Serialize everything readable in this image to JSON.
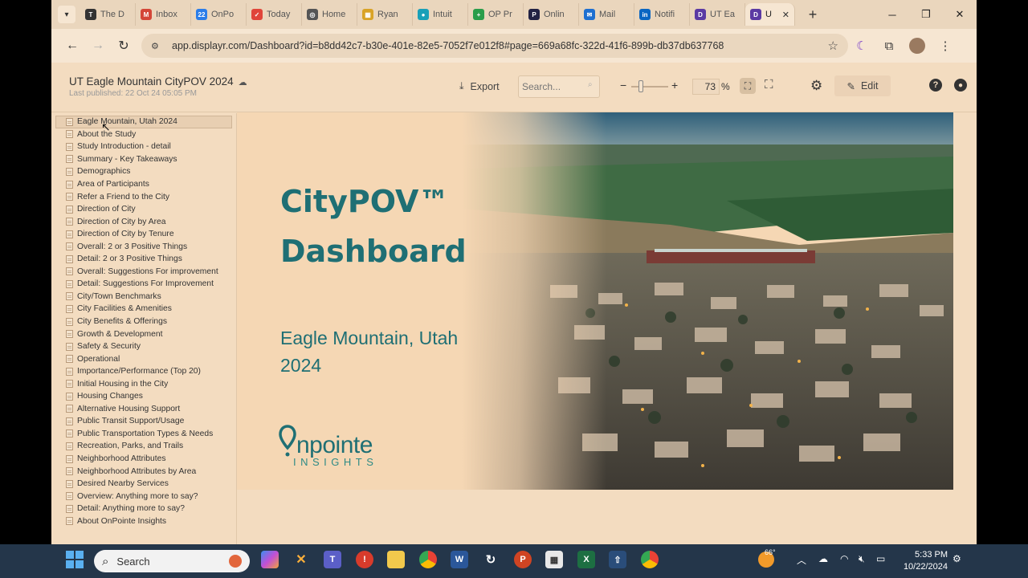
{
  "browser": {
    "tabs": [
      {
        "label": "The D",
        "color": "#333333",
        "glyph": "T"
      },
      {
        "label": "Inbox",
        "color": "#d44638",
        "glyph": "M"
      },
      {
        "label": "OnPo",
        "color": "#2b7de9",
        "glyph": "22"
      },
      {
        "label": "Today",
        "color": "#e0453a",
        "glyph": "✓"
      },
      {
        "label": "Home",
        "color": "#555555",
        "glyph": "◎"
      },
      {
        "label": "Ryan",
        "color": "#d9a326",
        "glyph": "▦"
      },
      {
        "label": "Intuit",
        "color": "#1aa0b8",
        "glyph": "●"
      },
      {
        "label": "OP Pr",
        "color": "#2a9d4a",
        "glyph": "+"
      },
      {
        "label": "Onlin",
        "color": "#222244",
        "glyph": "P"
      },
      {
        "label": "Mail",
        "color": "#1e6fd0",
        "glyph": "✉"
      },
      {
        "label": "Notifi",
        "color": "#0a66c2",
        "glyph": "in"
      },
      {
        "label": "UT Ea",
        "color": "#5b3aa3",
        "glyph": "D"
      }
    ],
    "active_tab": {
      "label": "U",
      "color": "#5b3aa3",
      "glyph": "D"
    },
    "url": "app.displayr.com/Dashboard?id=b8dd42c7-b30e-401e-82e5-7052f7e012f8#page=669a68fc-322d-41f6-899b-db37db637768"
  },
  "app": {
    "title": "UT Eagle Mountain CityPOV 2024",
    "published": "Last published: 22 Oct 24 05:05 PM",
    "export_label": "Export",
    "search_placeholder": "Search...",
    "zoom": "73",
    "zoom_unit": "%",
    "zoom_level": 0.25,
    "edit_label": "Edit"
  },
  "sidebar": {
    "items": [
      "Eagle Mountain, Utah 2024",
      "About the Study",
      "Study Introduction - detail",
      "Summary - Key Takeaways",
      "Demographics",
      "Area of Participants",
      "Refer a Friend to the City",
      "Direction of City",
      "Direction of City by Area",
      "Direction of City by Tenure",
      "Overall: 2 or 3 Positive Things",
      "Detail:  2 or 3 Positive Things",
      "Overall: Suggestions For improvement",
      "Detail:  Suggestions For Improvement",
      "City/Town Benchmarks",
      "City Facilities & Amenities",
      "City Benefits & Offerings",
      "Growth & Development",
      "Safety & Security",
      "Operational",
      "Importance/Performance (Top 20)",
      "Initial Housing in the City",
      "Housing Changes",
      "Alternative Housing Support",
      "Public Transit Support/Usage",
      "Public Transportation Types & Needs",
      "Recreation, Parks, and Trails",
      "Neighborhood Attributes",
      "Neighborhood Attributes by Area",
      "Desired Nearby Services",
      "Overview: Anything more to say?",
      "Detail:  Anything more to say?",
      "About OnPointe Insights"
    ]
  },
  "slide": {
    "title_line1": "CityPOV™",
    "title_line2": "Dashboard",
    "subtitle_line1": "Eagle Mountain, Utah",
    "subtitle_line2": "2024",
    "logo_word": "npointe",
    "logo_sub": "INSIGHTS",
    "accent_color": "#1f6f74"
  },
  "taskbar": {
    "search_label": "Search",
    "temperature": "66°",
    "time": "5:33 PM",
    "date": "10/22/2024"
  }
}
